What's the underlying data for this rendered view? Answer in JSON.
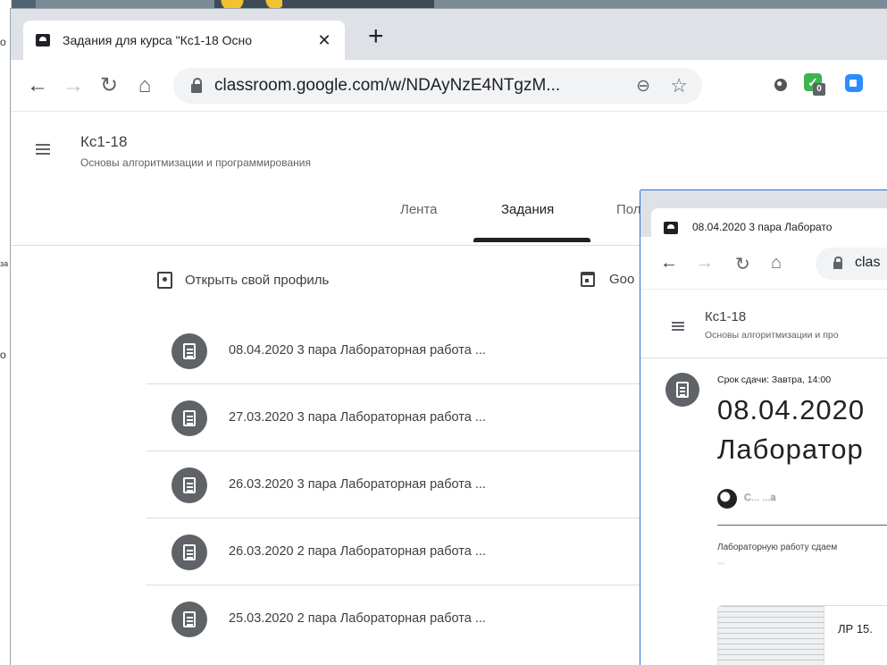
{
  "main_window": {
    "tab_title": "Задания для курса \"Кс1-18 Осно",
    "url": "classroom.google.com/w/NDAyNzE4NTgzM...",
    "ext_badge": "0",
    "course": {
      "title": "Кс1-18",
      "subtitle": "Основы алгоритмизации и программирования"
    },
    "tabs": [
      {
        "label": "Лента"
      },
      {
        "label": "Задания"
      },
      {
        "label": "Пол"
      }
    ],
    "profile_link": "Открыть свой профиль",
    "calendar_link": "Goo",
    "assignments": [
      {
        "title": "08.04.2020 3 пара Лабораторная работа ..."
      },
      {
        "title": "27.03.2020 3 пара Лабораторная работа ..."
      },
      {
        "title": "26.03.2020 3 пара Лабораторная работа ..."
      },
      {
        "title": "26.03.2020 2 пара Лабораторная работа ..."
      },
      {
        "title": "25.03.2020 2 пара Лабораторная работа ..."
      }
    ]
  },
  "second_window": {
    "tab_title": "08.04.2020 3 пара Лаборато",
    "url": "clas",
    "course": {
      "title": "Кс1-18",
      "subtitle": "Основы алгоритмизации и про"
    },
    "due": "Срок сдачи: Завтра, 14:00",
    "heading_line1": "08.04.2020",
    "heading_line2": "Лаборатор",
    "author": "С... ...а",
    "description": "Лабораторную работу сдаем",
    "description2": "...",
    "attachment_name": "ЛР 15."
  },
  "background": {
    "edge_texts": [
      "о",
      "за",
      "о"
    ]
  }
}
